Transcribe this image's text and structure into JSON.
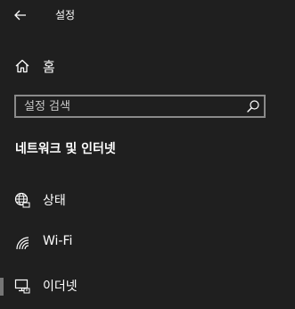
{
  "window": {
    "title": "설정"
  },
  "home": {
    "label": "홈",
    "icon": "home-icon"
  },
  "search": {
    "placeholder": "설정 검색",
    "icon": "search-icon"
  },
  "section": {
    "title": "네트워크 및 인터넷"
  },
  "nav_items": [
    {
      "label": "상태",
      "icon": "globe-status-icon"
    },
    {
      "label": "Wi-Fi",
      "icon": "wifi-icon"
    },
    {
      "label": "이더넷",
      "icon": "ethernet-icon",
      "selected": true
    }
  ],
  "colors": {
    "background": "#1f1f1f",
    "text": "#ffffff",
    "search_border": "#8a8a8a",
    "selection_indicator": "#767676"
  }
}
